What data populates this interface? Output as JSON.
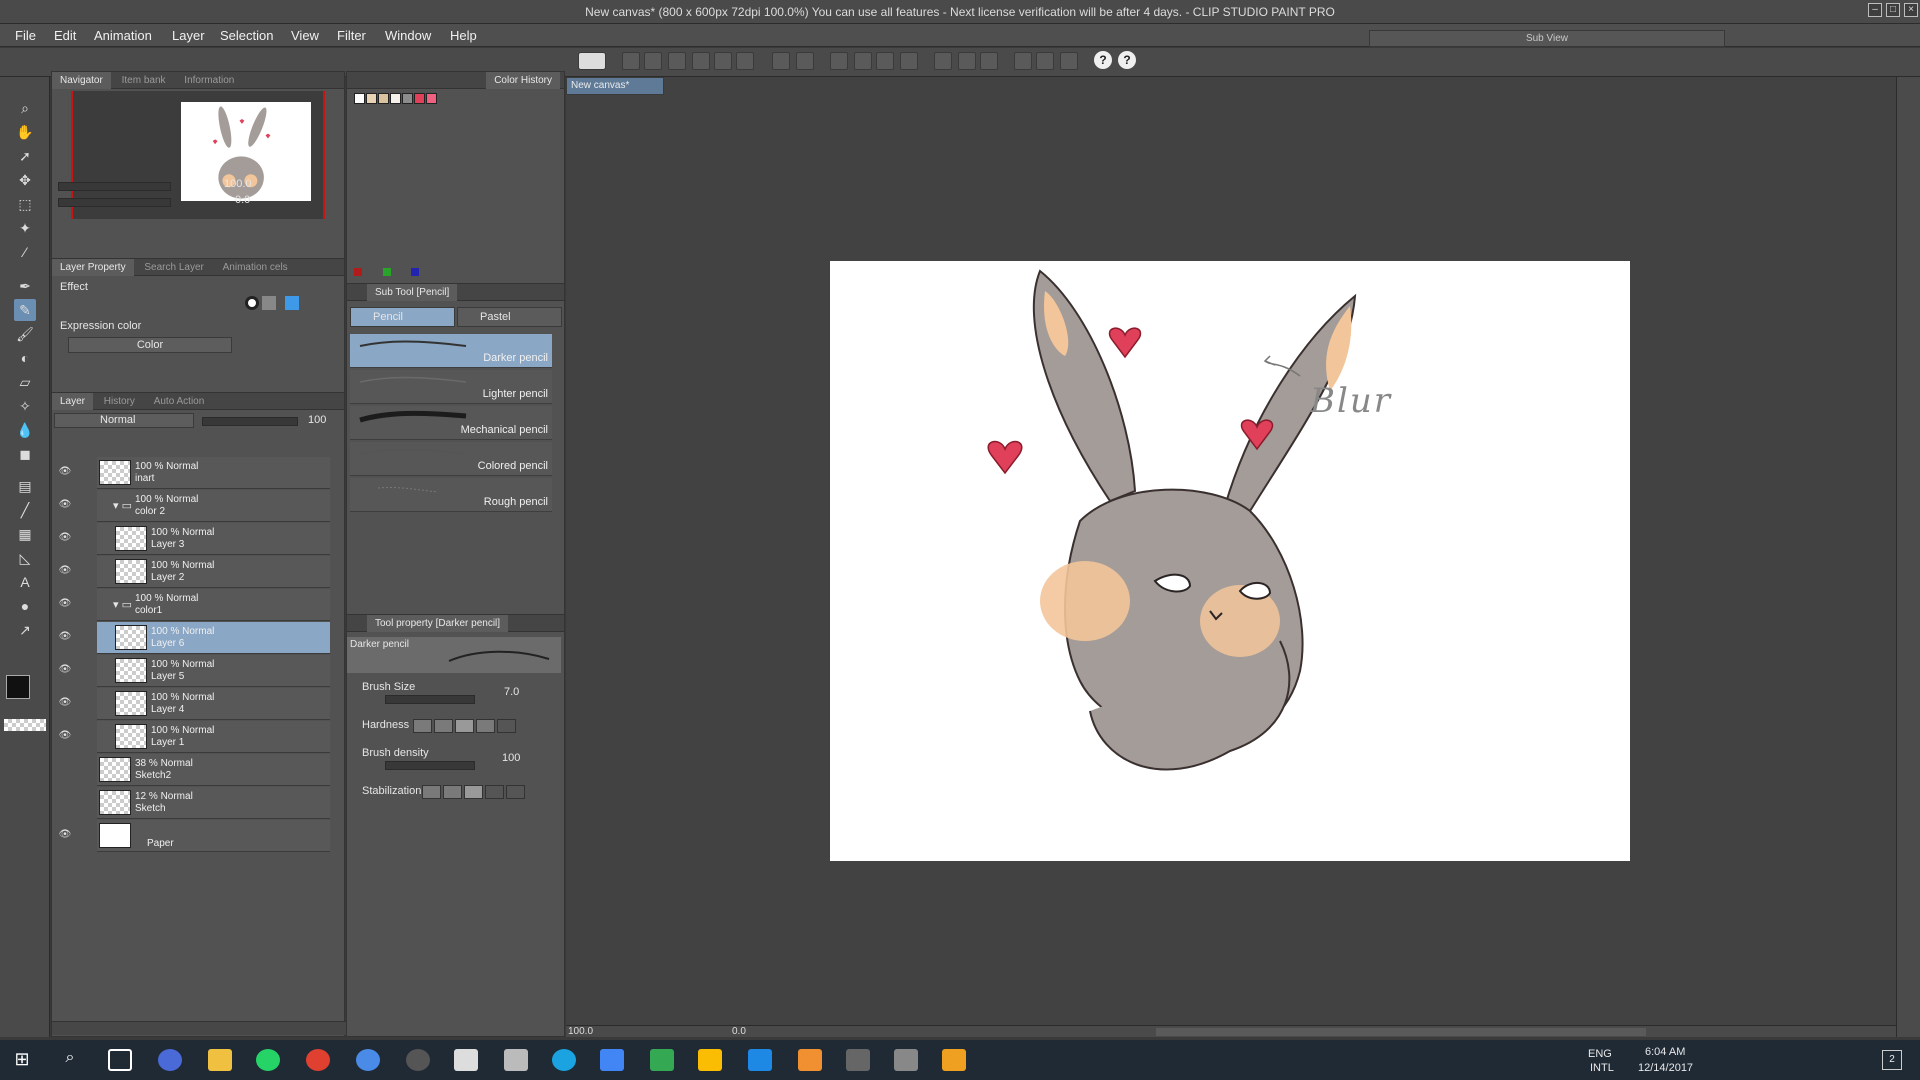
{
  "titlebar": {
    "title": "New canvas* (800 x 600px 72dpi 100.0%)  You can use all features - Next license verification will be after 4 days. - CLIP STUDIO PAINT PRO"
  },
  "menu": {
    "items": [
      "File",
      "Edit",
      "Animation",
      "Layer",
      "Selection",
      "View",
      "Filter",
      "Window",
      "Help"
    ]
  },
  "subview": {
    "title": "Sub View"
  },
  "navigator": {
    "tabs": [
      "Navigator",
      "Item bank",
      "Information"
    ],
    "zoom": "100.0",
    "rotation": "0.0"
  },
  "layer_property": {
    "tabs": [
      "Layer Property",
      "Search Layer",
      "Animation cels"
    ],
    "effect_label": "Effect",
    "expression_color_label": "Expression color",
    "expression_color_value": "Color"
  },
  "layer_panel": {
    "tabs": [
      "Layer",
      "History",
      "Auto Action"
    ],
    "blend_mode": "Normal",
    "opacity": "100",
    "layers": [
      {
        "mode": "100 % Normal",
        "name": "inart",
        "type": "layer",
        "indent": 0
      },
      {
        "mode": "100 % Normal",
        "name": "color 2",
        "type": "folder",
        "indent": 0
      },
      {
        "mode": "100 % Normal",
        "name": "Layer 3",
        "type": "layer",
        "indent": 1
      },
      {
        "mode": "100 % Normal",
        "name": "Layer 2",
        "type": "layer",
        "indent": 1
      },
      {
        "mode": "100 % Normal",
        "name": "color1",
        "type": "folder",
        "indent": 0
      },
      {
        "mode": "100 % Normal",
        "name": "Layer 6",
        "type": "layer",
        "indent": 1,
        "selected": true
      },
      {
        "mode": "100 % Normal",
        "name": "Layer 5",
        "type": "layer",
        "indent": 1
      },
      {
        "mode": "100 % Normal",
        "name": "Layer 4",
        "type": "layer",
        "indent": 1
      },
      {
        "mode": "100 % Normal",
        "name": "Layer 1",
        "type": "layer",
        "indent": 1
      },
      {
        "mode": "38 % Normal",
        "name": "Sketch2",
        "type": "layer",
        "indent": 0
      },
      {
        "mode": "12 % Normal",
        "name": "Sketch",
        "type": "layer",
        "indent": 0
      },
      {
        "mode": "",
        "name": "Paper",
        "type": "paper",
        "indent": 0
      }
    ]
  },
  "color_history": {
    "tab": "Color History",
    "swatches": [
      "#ffffff",
      "#e8d3b4",
      "#d9c2a0",
      "#f5f0ea",
      "#8c8c8c",
      "#e0405a",
      "#f06080"
    ]
  },
  "sub_tool": {
    "title": "Sub Tool [Pencil]",
    "groups": [
      "Pencil",
      "Pastel"
    ],
    "brushes": [
      "Darker pencil",
      "Lighter pencil",
      "Mechanical pencil",
      "Colored pencil",
      "Rough pencil"
    ]
  },
  "tool_property": {
    "title": "Tool property [Darker pencil]",
    "tool_name": "Darker pencil",
    "brush_size_label": "Brush Size",
    "brush_size_value": "7.0",
    "hardness_label": "Hardness",
    "brush_density_label": "Brush density",
    "brush_density_value": "100",
    "stabilization_label": "Stabilization"
  },
  "canvas": {
    "tab": "New canvas*",
    "annotation_text": "Blur",
    "status_zoom": "100.0",
    "status_angle": "0.0"
  },
  "taskbar": {
    "lang": "ENG",
    "kb": "INTL",
    "time": "6:04 AM",
    "date": "12/14/2017",
    "notifications": "2"
  },
  "colors": {
    "accent": "#8aa7c5",
    "fur": "#a49c98",
    "inner_ear": "#f3c59a",
    "heart": "#e0405a"
  }
}
